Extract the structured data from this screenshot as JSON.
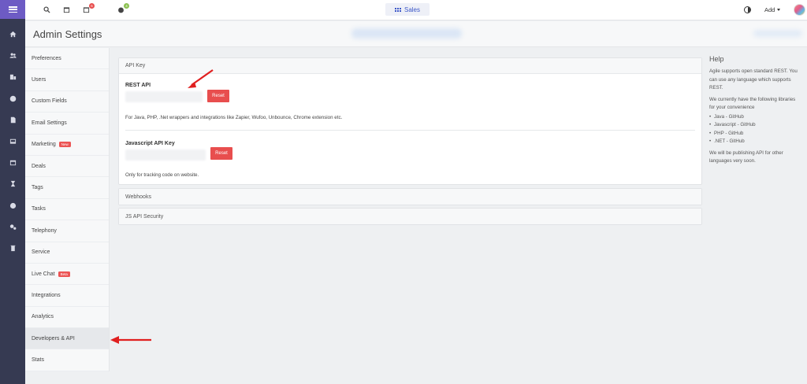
{
  "app": {
    "top_nav": {
      "center_label": "Sales",
      "add_label": "Add",
      "badges": [
        "6",
        "4"
      ]
    }
  },
  "header": {
    "title": "Admin Settings"
  },
  "sidebar_rail": {
    "icons": [
      "home-icon",
      "contacts-icon",
      "companies-icon",
      "deals-icon",
      "documents-icon",
      "inbox-icon",
      "calendar-icon",
      "campaigns-icon",
      "reports-icon",
      "settings-icon",
      "trash-icon"
    ]
  },
  "settings_nav": {
    "items": [
      {
        "label": "Preferences",
        "tag": ""
      },
      {
        "label": "Users",
        "tag": ""
      },
      {
        "label": "Custom Fields",
        "tag": ""
      },
      {
        "label": "Email Settings",
        "tag": ""
      },
      {
        "label": "Marketing",
        "tag": "New"
      },
      {
        "label": "Deals",
        "tag": ""
      },
      {
        "label": "Tags",
        "tag": ""
      },
      {
        "label": "Tasks",
        "tag": ""
      },
      {
        "label": "Telephony",
        "tag": ""
      },
      {
        "label": "Service",
        "tag": ""
      },
      {
        "label": "Live Chat",
        "tag": "Beta"
      },
      {
        "label": "Integrations",
        "tag": ""
      },
      {
        "label": "Analytics",
        "tag": ""
      },
      {
        "label": "Developers & API",
        "tag": ""
      },
      {
        "label": "Stats",
        "tag": ""
      }
    ],
    "active": "Developers & API"
  },
  "api_key_panel": {
    "title": "API Key",
    "rest": {
      "label": "REST API",
      "reset_label": "Reset",
      "description": "For Java, PHP, .Net wrappers and integrations like Zapier, Wufoo, Unbounce, Chrome extension etc."
    },
    "js": {
      "label": "Javascript API Key",
      "reset_label": "Reset",
      "description": "Only for tracking code on website."
    }
  },
  "webhooks_panel": {
    "title": "Webhooks"
  },
  "js_security_panel": {
    "title": "JS API Security"
  },
  "help": {
    "title": "Help",
    "intro": "Agile supports open standard REST. You can use any language which supports REST.",
    "libraries_intro": "We currently have the following libraries for your convenience",
    "libraries": [
      "Java - GitHub",
      "Javascript - GitHub",
      "PHP - GitHub",
      ".NET - GitHub"
    ],
    "footer": "We will be publishing API for other languages very soon."
  },
  "colors": {
    "rail": "#363a52",
    "rail_top": "#6d5bc4",
    "reset": "#e84e4e",
    "annotation": "#e02020"
  }
}
